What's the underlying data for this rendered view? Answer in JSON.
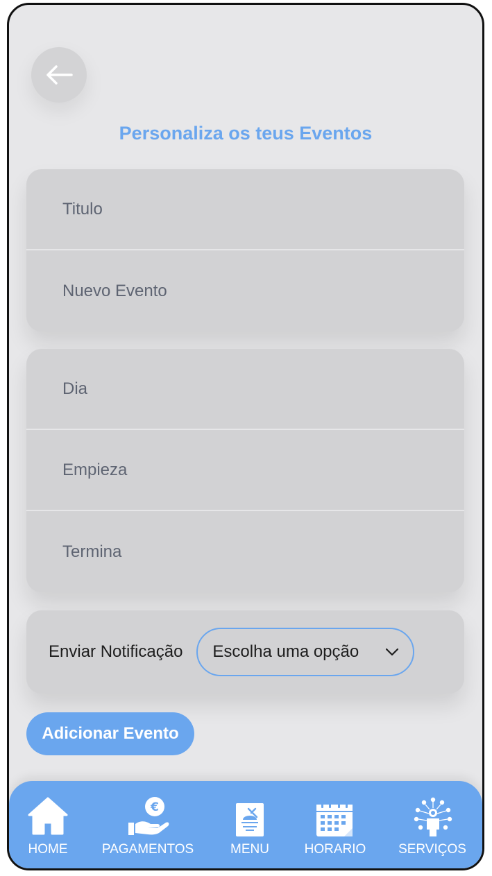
{
  "header": {
    "title": "Personaliza os teus Eventos"
  },
  "event_card": {
    "title_placeholder": "Titulo",
    "name_value": "Nuevo Evento"
  },
  "time_card": {
    "day_placeholder": "Dia",
    "start_placeholder": "Empieza",
    "end_placeholder": "Termina"
  },
  "notification": {
    "label": "Enviar Notificação",
    "selected": "Escolha uma opção"
  },
  "actions": {
    "add_event": "Adicionar Evento"
  },
  "tabs": [
    {
      "label": "HOME",
      "icon": "home-icon"
    },
    {
      "label": "PAGAMENTOS",
      "icon": "payments-icon"
    },
    {
      "label": "MENU",
      "icon": "menu-icon"
    },
    {
      "label": "HORARIO",
      "icon": "calendar-icon"
    },
    {
      "label": "SERVIÇOS",
      "icon": "services-icon"
    }
  ],
  "colors": {
    "accent": "#6aa6ee",
    "background": "#e7e7e9",
    "card": "#d2d2d4"
  }
}
